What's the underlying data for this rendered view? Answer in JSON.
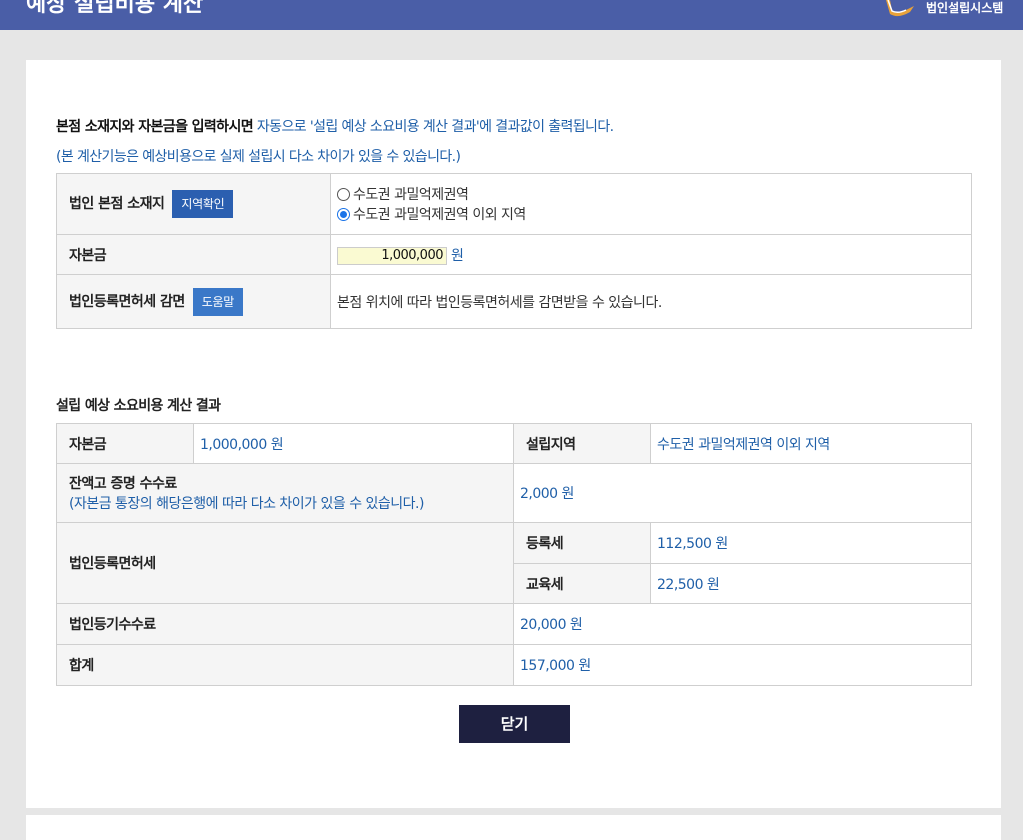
{
  "header": {
    "title": "예상 설립비용 계산",
    "brand": "법인설립시스템",
    "logo_icon": "pen-nib-logo-icon"
  },
  "intro": {
    "bold_part": "본점 소재지와 자본금을 입력하시면",
    "blue_part": " 자동으로 '설립 예상 소요비용 계산 결과'에 결과값이 출력됩니다.",
    "note": "(본 계산기능은 예상비용으로 실제 설립시 다소 차이가 있을 수 있습니다.)"
  },
  "input_form": {
    "location_label": "법인 본점 소재지",
    "region_check_button": "지역확인",
    "radio_options": [
      {
        "label": "수도권 과밀억제권역",
        "selected": false
      },
      {
        "label": "수도권 과밀억제권역 이외 지역",
        "selected": true
      }
    ],
    "capital_label": "자본금",
    "capital_value": "1,000,000",
    "capital_unit": "원",
    "tax_reduction_label": "법인등록면허세 감면",
    "help_button": "도움말",
    "tax_reduction_text": "본점 위치에 따라 법인등록면허세를 감면받을 수 있습니다."
  },
  "result": {
    "section_title": "설립 예상 소요비용 계산 결과",
    "capital_label": "자본금",
    "capital_value": "1,000,000 원",
    "region_label": "설립지역",
    "region_value": "수도권 과밀억제권역 이외 지역",
    "balance_cert_label": "잔액고 증명 수수료",
    "balance_cert_note": "(자본금 통장의 해당은행에 따라 다소 차이가 있을 수 있습니다.)",
    "balance_cert_value": "2,000 원",
    "license_tax_label": "법인등록면허세",
    "registration_tax_label": "등록세",
    "registration_tax_value": "112,500 원",
    "education_tax_label": "교육세",
    "education_tax_value": "22,500 원",
    "registry_fee_label": "법인등기수수료",
    "registry_fee_value": "20,000 원",
    "total_label": "합계",
    "total_value": "157,000 원"
  },
  "close_button": "닫기",
  "colors": {
    "header_bg": "#4a5ea7",
    "accent_blue": "#1f5fa8",
    "button_blue": "#2b5fb0",
    "close_button_bg": "#1e2040",
    "amount_field_bg": "#fafad2"
  }
}
